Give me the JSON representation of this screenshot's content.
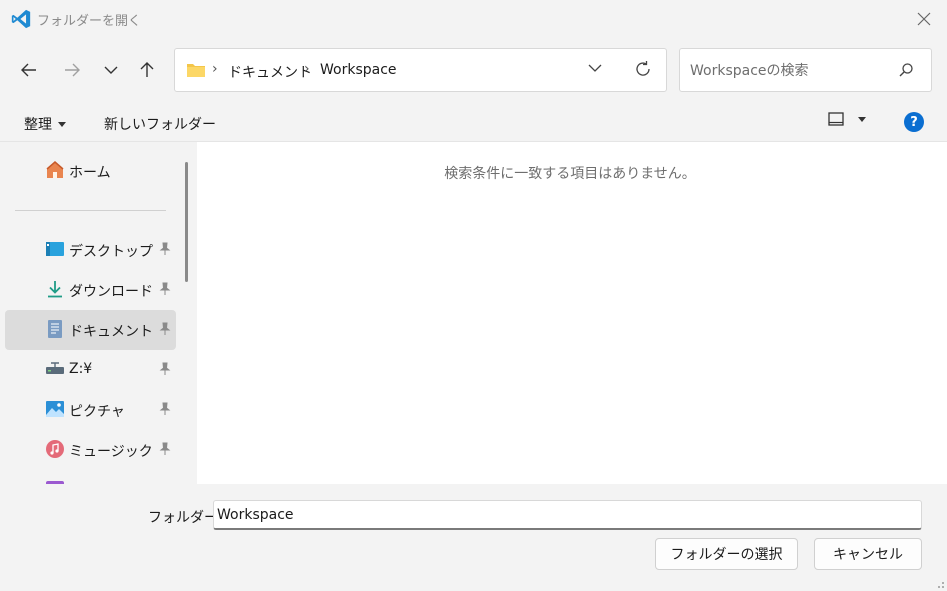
{
  "window": {
    "title": "フォルダーを開く",
    "accent": "#0a6ed1"
  },
  "address": {
    "crumbs": [
      "ドキュメント",
      "Workspace"
    ]
  },
  "search": {
    "placeholder": "Workspaceの検索"
  },
  "toolbar": {
    "organize_label": "整理",
    "new_folder_label": "新しいフォルダー"
  },
  "sidebar": {
    "items": [
      {
        "label": "ホーム",
        "icon": "home-icon",
        "pinned": false,
        "selected": false
      },
      {
        "label": "デスクトップ",
        "icon": "desktop-icon",
        "pinned": true,
        "selected": false
      },
      {
        "label": "ダウンロード",
        "icon": "download-icon",
        "pinned": true,
        "selected": false
      },
      {
        "label": "ドキュメント",
        "icon": "documents-icon",
        "pinned": true,
        "selected": true
      },
      {
        "label": "Z:¥",
        "icon": "network-drive-icon",
        "pinned": true,
        "selected": false
      },
      {
        "label": "ピクチャ",
        "icon": "pictures-icon",
        "pinned": true,
        "selected": false
      },
      {
        "label": "ミュージック",
        "icon": "music-icon",
        "pinned": true,
        "selected": false
      }
    ]
  },
  "content": {
    "empty_message": "検索条件に一致する項目はありません。"
  },
  "footer": {
    "folder_label": "フォルダー:",
    "folder_value": "Workspace",
    "select_button": "フォルダーの選択",
    "cancel_button": "キャンセル"
  }
}
